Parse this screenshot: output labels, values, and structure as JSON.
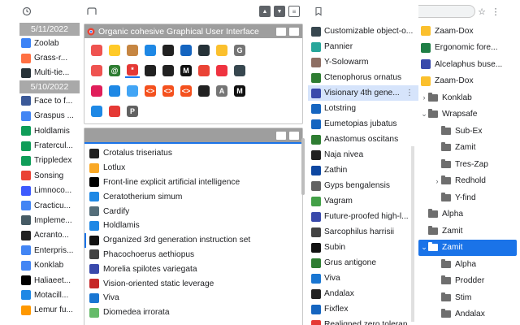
{
  "toolbars": {
    "history_icon": "history-icon",
    "bar_icon": "window-icon",
    "bookmark_icon": "bookmark-icon",
    "search_icon": "search-icon",
    "star_icon": "star-icon",
    "menu_icon": "more-vert-icon"
  },
  "history": {
    "groups": [
      {
        "date": "5/11/2022",
        "items": [
          {
            "label": "Zoolab",
            "icon": "#3b82f6"
          },
          {
            "label": "Grass-r...",
            "icon": "#ff7043"
          },
          {
            "label": "Multi-tie...",
            "icon": "#263238"
          }
        ]
      },
      {
        "date": "5/10/2022",
        "items": [
          {
            "label": "Face to f...",
            "icon": "#3b5998"
          },
          {
            "label": "Graspus ...",
            "icon": "#4285f4"
          },
          {
            "label": "Holdlamis",
            "icon": "#0f9d58"
          },
          {
            "label": "Fratercul...",
            "icon": "#0f9d58"
          },
          {
            "label": "Trippledex",
            "icon": "#0f9d58"
          },
          {
            "label": "Sonsing",
            "icon": "#ea4335"
          },
          {
            "label": "Limnoco...",
            "icon": "#3d5afe"
          },
          {
            "label": "Cracticu...",
            "icon": "#4285f4"
          },
          {
            "label": "Impleme...",
            "icon": "#455a64"
          },
          {
            "label": "Acranto...",
            "icon": "#212121"
          },
          {
            "label": "Enterpris...",
            "icon": "#4285f4"
          },
          {
            "label": "Konklab",
            "icon": "#4285f4"
          },
          {
            "label": "Haliaeet...",
            "icon": "#000000"
          },
          {
            "label": "Motacill...",
            "icon": "#1e88e5"
          },
          {
            "label": "Lemur fu...",
            "icon": "#ff9800"
          }
        ]
      }
    ]
  },
  "window_panel": {
    "title": "Organic cohesive Graphical User Interface",
    "icons": [
      {
        "name": "rainbow-icon",
        "bg": "#ef5350",
        "t": ""
      },
      {
        "name": "rainbow-icon",
        "bg": "#ffca28",
        "t": ""
      },
      {
        "name": "avatar-icon",
        "bg": "#c68642",
        "t": ""
      },
      {
        "name": "flag-icon",
        "bg": "#1e88e5",
        "t": ""
      },
      {
        "name": "github-icon",
        "bg": "#212121",
        "t": ""
      },
      {
        "name": "book-icon",
        "bg": "#1565c0",
        "t": ""
      },
      {
        "name": "shield-icon",
        "bg": "#263238",
        "t": ""
      },
      {
        "name": "bulb-icon",
        "bg": "#fbc02d",
        "t": ""
      },
      {
        "name": "g-icon",
        "bg": "#757575",
        "t": "G"
      },
      {
        "name": "blank",
        "bg": "#ffffff",
        "t": ""
      },
      {
        "name": "rainbow-icon",
        "bg": "#ef5350",
        "t": ""
      },
      {
        "name": "at-icon",
        "bg": "#2e7d32",
        "t": "@"
      },
      {
        "name": "asterisk-icon",
        "bg": "#e53935",
        "t": "*"
      },
      {
        "name": "github-icon",
        "bg": "#212121",
        "t": ""
      },
      {
        "name": "github-icon",
        "bg": "#212121",
        "t": ""
      },
      {
        "name": "m-icon",
        "bg": "#111111",
        "t": "M"
      },
      {
        "name": "chrome-icon",
        "bg": "#ea4335",
        "t": ""
      },
      {
        "name": "pocket-icon",
        "bg": "#ef3340",
        "t": ""
      },
      {
        "name": "arrow-icon",
        "bg": "#37474f",
        "t": ""
      },
      {
        "name": "blank",
        "bg": "#ffffff",
        "t": ""
      },
      {
        "name": "slack-icon",
        "bg": "#e01e5a",
        "t": ""
      },
      {
        "name": "cloud-icon",
        "bg": "#1e88e5",
        "t": ""
      },
      {
        "name": "edit-icon",
        "bg": "#42a5f5",
        "t": ""
      },
      {
        "name": "code-icon",
        "bg": "#f4511e",
        "t": "<>"
      },
      {
        "name": "code-icon",
        "bg": "#f4511e",
        "t": "<>"
      },
      {
        "name": "code-icon",
        "bg": "#f4511e",
        "t": "<>"
      },
      {
        "name": "github-icon",
        "bg": "#212121",
        "t": ""
      },
      {
        "name": "a-icon",
        "bg": "#757575",
        "t": "A"
      },
      {
        "name": "m-icon",
        "bg": "#111111",
        "t": "M"
      },
      {
        "name": "blank",
        "bg": "#ffffff",
        "t": ""
      },
      {
        "name": "puzzle-icon",
        "bg": "#1e88e5",
        "t": ""
      },
      {
        "name": "bug-icon",
        "bg": "#e53935",
        "t": ""
      },
      {
        "name": "p-icon",
        "bg": "#616161",
        "t": "P"
      }
    ]
  },
  "tabs_panel": {
    "items": [
      {
        "label": "Crotalus triseriatus",
        "icon": "#212121"
      },
      {
        "label": "Lotlux",
        "icon": "#f9a825"
      },
      {
        "label": "Front-line explicit artificial intelligence",
        "icon": "#000000"
      },
      {
        "label": "Ceratotherium simum",
        "icon": "#1e88e5"
      },
      {
        "label": "Cardify",
        "icon": "#546e7a"
      },
      {
        "label": "Holdlamis",
        "icon": "#1e88e5"
      },
      {
        "label": "Organized 3rd generation instruction set",
        "icon": "#111111"
      },
      {
        "label": "Phacochoerus aethiopus",
        "icon": "#424242"
      },
      {
        "label": "Morelia spilotes variegata",
        "icon": "#3949ab"
      },
      {
        "label": "Vision-oriented static leverage",
        "icon": "#c62828"
      },
      {
        "label": "Viva",
        "icon": "#1976d2"
      },
      {
        "label": "Diomedea irrorata",
        "icon": "#66bb6a"
      }
    ]
  },
  "bookmarks": {
    "items": [
      {
        "label": "Customizable object-o...",
        "icon": "#37474f"
      },
      {
        "label": "Pannier",
        "icon": "#26a69a"
      },
      {
        "label": "Y-Solowarm",
        "icon": "#8d6e63"
      },
      {
        "label": "Ctenophorus ornatus",
        "icon": "#2e7d32"
      },
      {
        "label": "Visionary 4th gene...",
        "icon": "#3949ab"
      },
      {
        "label": "Lotstring",
        "icon": "#1565c0"
      },
      {
        "label": "Eumetopias jubatus",
        "icon": "#1565c0"
      },
      {
        "label": "Anastomus oscitans",
        "icon": "#2e7d32"
      },
      {
        "label": "Naja nivea",
        "icon": "#212121"
      },
      {
        "label": "Zathin",
        "icon": "#0d47a1"
      },
      {
        "label": "Gyps bengalensis",
        "icon": "#616161"
      },
      {
        "label": "Vagram",
        "icon": "#43a047"
      },
      {
        "label": "Future-proofed high-l...",
        "icon": "#3949ab"
      },
      {
        "label": "Sarcophilus harrisii",
        "icon": "#424242"
      },
      {
        "label": "Subin",
        "icon": "#111111"
      },
      {
        "label": "Grus antigone",
        "icon": "#2e7d32"
      },
      {
        "label": "Viva",
        "icon": "#1976d2"
      },
      {
        "label": "Andalax",
        "icon": "#212121"
      },
      {
        "label": "Fixflex",
        "icon": "#1565c0"
      },
      {
        "label": "Realigned zero toleran...",
        "icon": "#e53935"
      }
    ]
  },
  "tree": {
    "items": [
      {
        "label": "Zaam-Dox",
        "depth": 0,
        "caret": "",
        "kind": "page",
        "icon": "#fbc02d"
      },
      {
        "label": "Ergonomic fore...",
        "depth": 0,
        "caret": "",
        "kind": "page",
        "icon": "#1e7e45"
      },
      {
        "label": "Alcelaphus buse...",
        "depth": 0,
        "caret": "",
        "kind": "page",
        "icon": "#3949ab"
      },
      {
        "label": "Zaam-Dox",
        "depth": 0,
        "caret": "",
        "kind": "page",
        "icon": "#fbc02d"
      },
      {
        "label": "Konklab",
        "depth": 0,
        "caret": "›",
        "kind": "folder"
      },
      {
        "label": "Wrapsafe",
        "depth": 0,
        "caret": "⌄",
        "kind": "folder"
      },
      {
        "label": "Sub-Ex",
        "depth": 1,
        "caret": "",
        "kind": "folder"
      },
      {
        "label": "Zamit",
        "depth": 1,
        "caret": "",
        "kind": "folder"
      },
      {
        "label": "Tres-Zap",
        "depth": 1,
        "caret": "",
        "kind": "folder"
      },
      {
        "label": "Redhold",
        "depth": 1,
        "caret": "›",
        "kind": "folder"
      },
      {
        "label": "Y-find",
        "depth": 1,
        "caret": "",
        "kind": "folder"
      },
      {
        "label": "Alpha",
        "depth": 0,
        "caret": "",
        "kind": "folder"
      },
      {
        "label": "Zamit",
        "depth": 0,
        "caret": "",
        "kind": "folder"
      },
      {
        "label": "Zamit",
        "depth": 0,
        "caret": "⌄",
        "kind": "folder",
        "selected": true
      },
      {
        "label": "Alpha",
        "depth": 1,
        "caret": "",
        "kind": "folder"
      },
      {
        "label": "Prodder",
        "depth": 1,
        "caret": "",
        "kind": "folder"
      },
      {
        "label": "Stim",
        "depth": 1,
        "caret": "",
        "kind": "folder"
      },
      {
        "label": "Andalax",
        "depth": 1,
        "caret": "",
        "kind": "folder"
      }
    ]
  },
  "colors": {
    "accent": "#1a73e8",
    "panel_header": "#9e9e9e",
    "date_header": "#a9a9a9"
  }
}
